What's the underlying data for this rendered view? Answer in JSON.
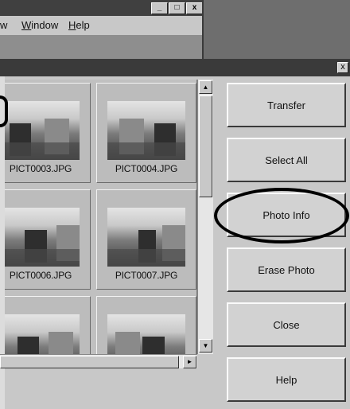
{
  "background_app": {
    "window_buttons": [
      "_",
      "□",
      "x"
    ],
    "menu": [
      {
        "label": "w",
        "underline": ""
      },
      {
        "label": "indow",
        "underline": "W"
      },
      {
        "label": "elp",
        "underline": "H"
      }
    ]
  },
  "dialog": {
    "close_glyph": "x"
  },
  "thumbnails": [
    {
      "label": "PICT0003.JPG"
    },
    {
      "label": "PICT0004.JPG"
    },
    {
      "label": "PICT0006.JPG"
    },
    {
      "label": "PICT0007.JPG"
    },
    {
      "label": ""
    },
    {
      "label": ""
    }
  ],
  "scrollbar": {
    "up": "▲",
    "down": "▼",
    "right": "►"
  },
  "actions": [
    {
      "label": "Transfer"
    },
    {
      "label": "Select All"
    },
    {
      "label": "Photo Info"
    },
    {
      "label": "Erase Photo"
    },
    {
      "label": "Close"
    },
    {
      "label": "Help"
    }
  ],
  "highlight": {
    "target": "Photo Info"
  }
}
